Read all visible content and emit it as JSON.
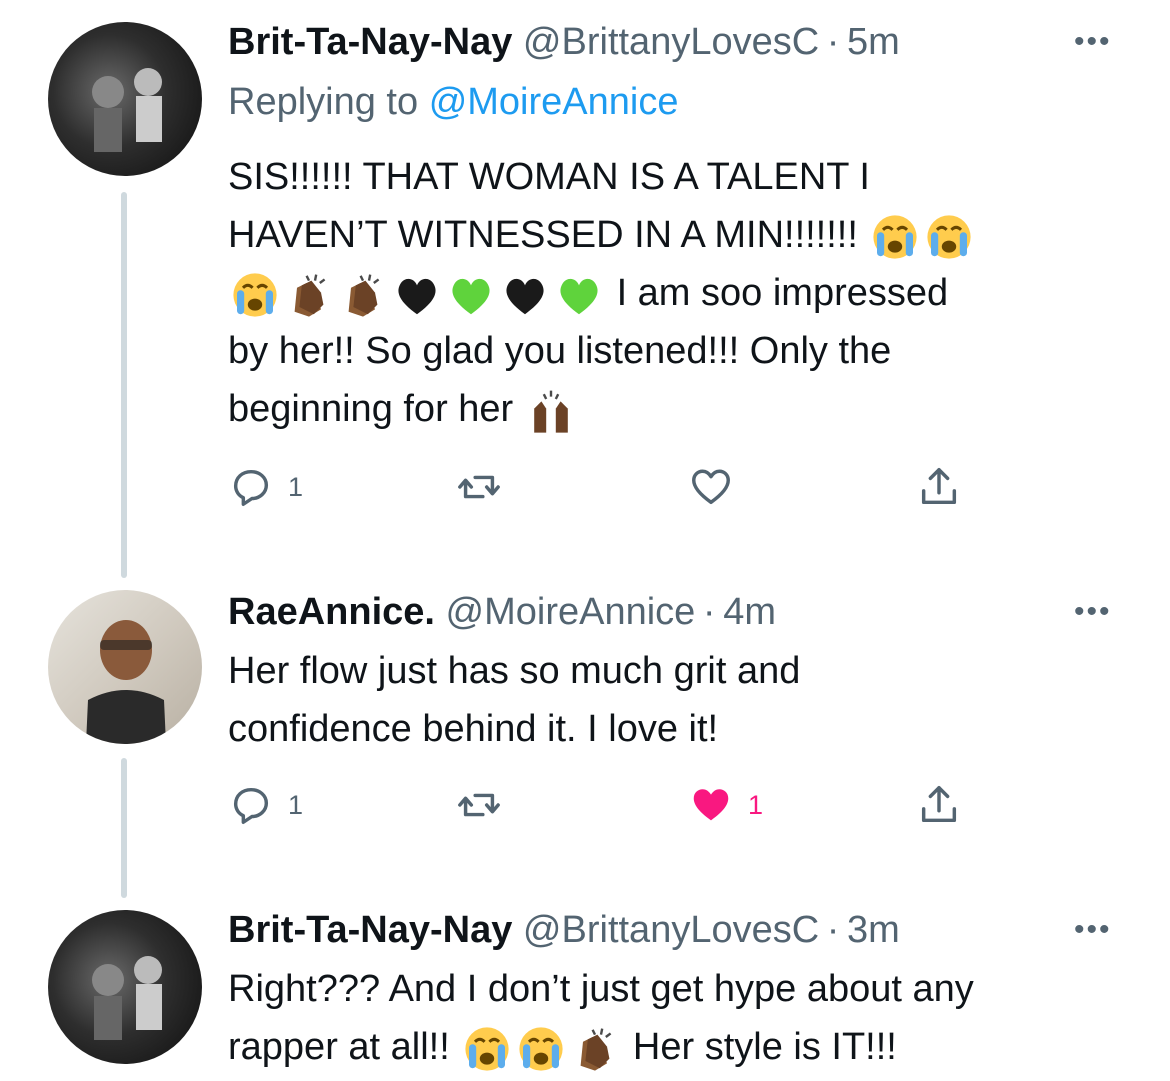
{
  "tweets": [
    {
      "name": "Brit-Ta-Nay-Nay",
      "handle": "@BrittanyLovesC",
      "separator": "·",
      "time": "5m",
      "replying_label": "Replying to",
      "replying_to": "@MoireAnnice",
      "lines": [
        "SIS!!!!!! THAT WOMAN IS A TALENT I",
        "HAVEN’T WITNESSED IN A MIN!!!!!!!",
        "I am soo impressed",
        "by her!! So glad you listened!!! Only the",
        "beginning for her"
      ],
      "emoji": [
        "loudly-crying-face",
        "clapping-hands",
        "black-heart",
        "green-heart",
        "raising-hands"
      ],
      "replies": "1",
      "likes": ""
    },
    {
      "name": "RaeAnnice.",
      "handle": "@MoireAnnice",
      "separator": "·",
      "time": "4m",
      "lines": [
        "Her flow just has so much grit and",
        "confidence behind it. I love it!"
      ],
      "replies": "1",
      "likes": "1"
    },
    {
      "name": "Brit-Ta-Nay-Nay",
      "handle": "@BrittanyLovesC",
      "separator": "·",
      "time": "3m",
      "lines": [
        "Right??? And I don’t just get hype about any",
        "rapper at all!!",
        "Her style is IT!!!"
      ]
    }
  ],
  "more_label": "•••",
  "colors": {
    "link": "#1d9bf0",
    "secondary": "#536471",
    "like": "#f91880",
    "thread": "#cfd9de"
  }
}
